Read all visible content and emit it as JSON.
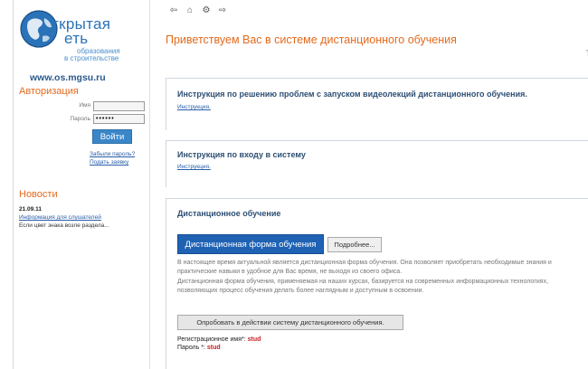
{
  "sidebar": {
    "logo": {
      "word1": "ткрытая",
      "word2": "еть",
      "small1": "образования",
      "small2": "в строительстве"
    },
    "site_url": "www.os.mgsu.ru",
    "auth": {
      "title": "Авторизация",
      "login_label": "Имя",
      "login_value": "",
      "password_label": "Пароль",
      "password_value": "••••••",
      "login_button": "Войти",
      "forgot_link": "Забыли пароль?",
      "register_link": "Подать заявку"
    },
    "news": {
      "title": "Новости",
      "date": "21.09.11",
      "link": "Информация для слушателей",
      "text": "Если цвет знака  возле раздела..."
    }
  },
  "main": {
    "nav": {
      "back_icon": "back-arrow-icon",
      "home_icon": "home-icon",
      "sitemap_icon": "sitemap-icon",
      "forward_icon": "forward-arrow-icon"
    },
    "page_title": "Приветствуем Вас в системе дистанционного обучения",
    "right_marker": "T",
    "panels": [
      {
        "title": "Инструкция по решению проблем с запуском видеолекций дистанционного обучения.",
        "link": "Инструкция."
      },
      {
        "title": "Инструкция по входу в систему",
        "link": "Инструкция."
      },
      {
        "title": "Дистанционное обучение",
        "primary_button": "Дистанционная форма обучения",
        "more_button": "Подробнее...",
        "desc1": "В настоящее время актуальной является дистанционная форма обучения. Она позволяет приобретать необходимые знания и практические навыки в удобное для Вас время, не выходя из своего офиса.",
        "desc2": "Дистанционная форма обучения, применяемая на наших курсах, базируется на современных информационных технологиях, позволяющих процесс обучения делать более наглядным и доступным в освоении.",
        "try_button": "Опробовать в действии систему дистанционного обучения.",
        "user_label": "Регистрационное имя*:",
        "user_value": "stud",
        "pass_label": "Пароль *:",
        "pass_value": "stud"
      }
    ]
  },
  "colors": {
    "accent_orange": "#e46a1e",
    "link_blue": "#2a5ea8",
    "primary_button": "#1f62b4",
    "credential_red": "#c62020"
  }
}
